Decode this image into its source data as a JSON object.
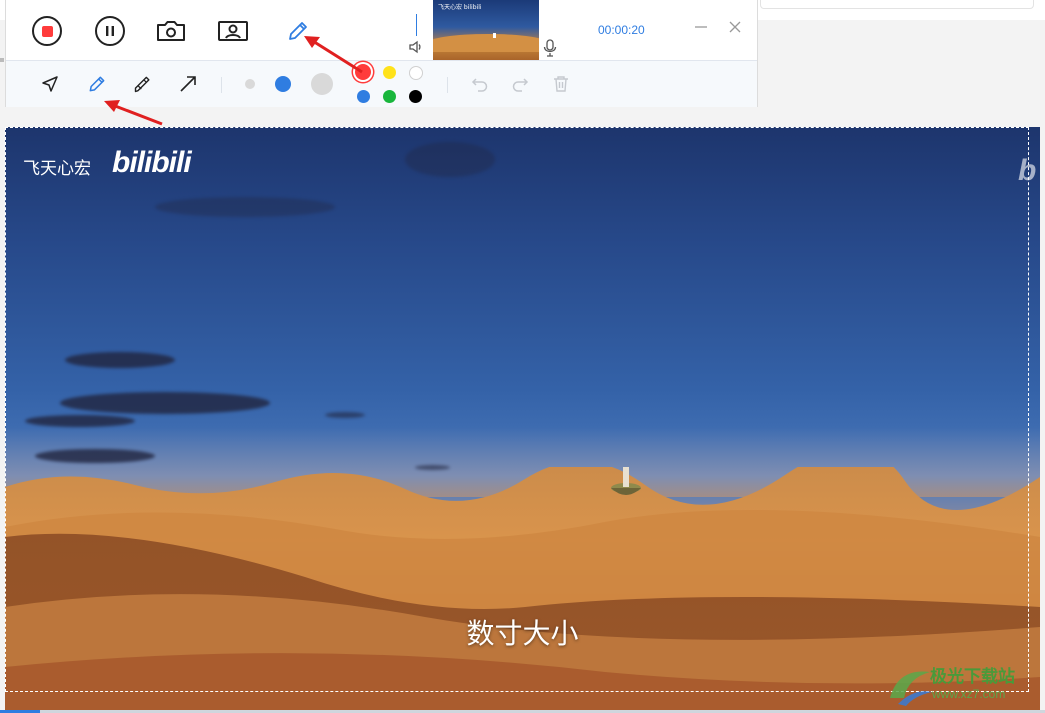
{
  "recorder": {
    "timer": "00:00:20",
    "preview": {
      "watermark": "飞天心宏 bilibili"
    },
    "colors": {
      "accent": "#2f7de1",
      "stop": "#ff3b3b",
      "palette": [
        "#ff3b3b",
        "#ffe21a",
        "#ffffff",
        "#2f7de1",
        "#19b63c",
        "#000000"
      ],
      "selected_palette": "#ff3b3b"
    },
    "top_icons": [
      "stop-record-icon",
      "pause-icon",
      "camera-icon",
      "webcam-icon",
      "pen-icon",
      "speaker-icon",
      "microphone-icon",
      "minimize-icon",
      "close-icon"
    ],
    "draw_tools": [
      "select-arrow-icon",
      "pen-icon",
      "highlighter-icon",
      "line-arrow-icon"
    ],
    "brush_sizes": [
      "small",
      "medium",
      "large"
    ],
    "selected_tool": "pen",
    "selected_size": "medium",
    "history_icons": [
      "undo-icon",
      "redo-icon",
      "delete-icon"
    ]
  },
  "video": {
    "watermark_text": "飞天心宏",
    "watermark_brand": "bilibili",
    "watermark_edge": "b",
    "subtitle": "数寸大小"
  },
  "site": {
    "name": "极光下载站",
    "url": "www.xz7.com"
  },
  "annotations": {
    "arrow_color": "#e02020",
    "count": 2
  }
}
